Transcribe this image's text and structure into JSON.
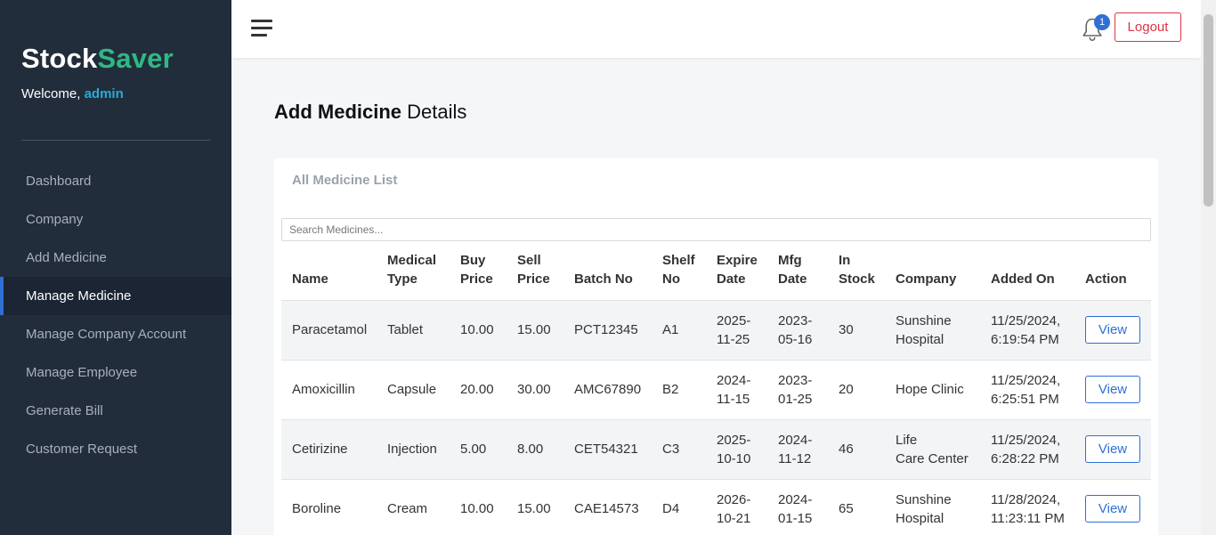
{
  "sidebar": {
    "brand_part1": "Stock",
    "brand_part2": "Saver",
    "welcome_prefix": "Welcome,",
    "username": "admin",
    "items": [
      {
        "label": "Dashboard"
      },
      {
        "label": "Company"
      },
      {
        "label": "Add Medicine"
      },
      {
        "label": "Manage Medicine",
        "active": true
      },
      {
        "label": "Manage Company Account"
      },
      {
        "label": "Manage Employee"
      },
      {
        "label": "Generate Bill"
      },
      {
        "label": "Customer Request"
      }
    ]
  },
  "topbar": {
    "notification_count": "1",
    "logout_label": "Logout"
  },
  "page": {
    "title_strong": "Add Medicine",
    "title_rest": "Details"
  },
  "card": {
    "title": "All Medicine List",
    "search_placeholder": "Search Medicines..."
  },
  "table": {
    "headers": [
      [
        "Name"
      ],
      [
        "Medical",
        "Type"
      ],
      [
        "Buy",
        "Price"
      ],
      [
        "Sell",
        "Price"
      ],
      [
        "Batch No"
      ],
      [
        "Shelf",
        "No"
      ],
      [
        "Expire",
        "Date"
      ],
      [
        "Mfg",
        "Date"
      ],
      [
        "In",
        "Stock"
      ],
      [
        "Company"
      ],
      [
        "Added On"
      ],
      [
        "Action"
      ]
    ],
    "view_label": "View",
    "rows": [
      {
        "name": "Paracetamol",
        "type": "Tablet",
        "buy": "10.00",
        "sell": "15.00",
        "batch": "PCT12345",
        "shelf": "A1",
        "expire": [
          "2025-",
          "11-25"
        ],
        "mfg": [
          "2023-",
          "05-16"
        ],
        "stock": "30",
        "company": [
          "Sunshine",
          "Hospital"
        ],
        "added": [
          "11/25/2024,",
          "6:19:54 PM"
        ]
      },
      {
        "name": "Amoxicillin",
        "type": "Capsule",
        "buy": "20.00",
        "sell": "30.00",
        "batch": "AMC67890",
        "shelf": "B2",
        "expire": [
          "2024-",
          "11-15"
        ],
        "mfg": [
          "2023-",
          "01-25"
        ],
        "stock": "20",
        "company": [
          "Hope Clinic"
        ],
        "added": [
          "11/25/2024,",
          "6:25:51 PM"
        ]
      },
      {
        "name": "Cetirizine",
        "type": "Injection",
        "buy": "5.00",
        "sell": "8.00",
        "batch": "CET54321",
        "shelf": "C3",
        "expire": [
          "2025-",
          "10-10"
        ],
        "mfg": [
          "2024-",
          "11-12"
        ],
        "stock": "46",
        "company": [
          "Life",
          "Care Center"
        ],
        "added": [
          "11/25/2024,",
          "6:28:22 PM"
        ]
      },
      {
        "name": "Boroline",
        "type": "Cream",
        "buy": "10.00",
        "sell": "15.00",
        "batch": "CAE14573",
        "shelf": "D4",
        "expire": [
          "2026-",
          "10-21"
        ],
        "mfg": [
          "2024-",
          "01-15"
        ],
        "stock": "65",
        "company": [
          "Sunshine",
          "Hospital"
        ],
        "added": [
          "11/28/2024,",
          "11:23:11 PM"
        ]
      }
    ]
  },
  "icons": {
    "menu": "hamburger-icon",
    "bell": "bell-icon"
  },
  "colors": {
    "sidebar_bg": "#222d3b",
    "brand_accent": "#2fb985",
    "username": "#29a9d9",
    "primary": "#2f6fd6",
    "danger": "#dc3545"
  }
}
